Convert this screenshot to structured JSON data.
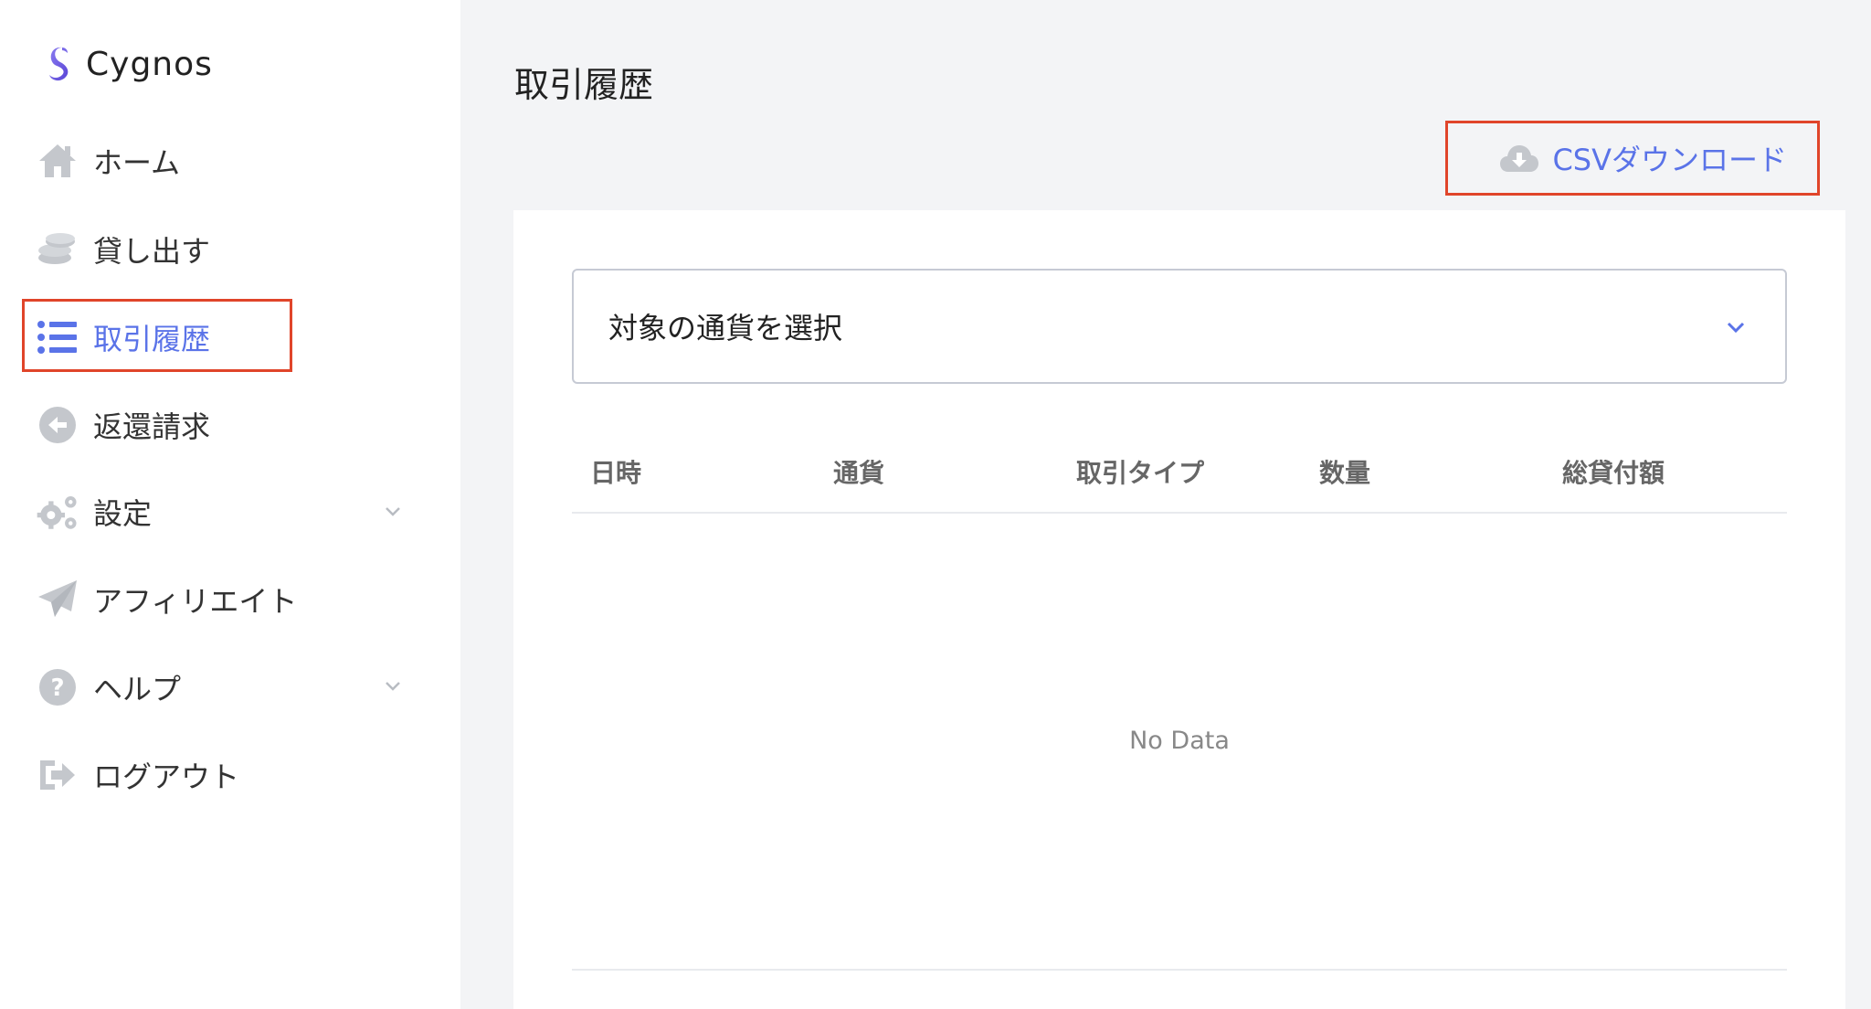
{
  "brand": {
    "name": "Cygnos",
    "color": "#6b5be6"
  },
  "sidebar": {
    "items": [
      {
        "label": "ホーム",
        "icon": "home-icon"
      },
      {
        "label": "貸し出す",
        "icon": "coins-icon"
      },
      {
        "label": "取引履歴",
        "icon": "list-icon",
        "active": true
      },
      {
        "label": "返還請求",
        "icon": "arrow-left-circle-icon"
      },
      {
        "label": "設定",
        "icon": "gears-icon",
        "expandable": true
      },
      {
        "label": "アフィリエイト",
        "icon": "paper-plane-icon"
      },
      {
        "label": "ヘルプ",
        "icon": "question-circle-icon",
        "expandable": true
      },
      {
        "label": "ログアウト",
        "icon": "logout-icon"
      }
    ]
  },
  "main": {
    "title": "取引履歴",
    "csv_download_label": "CSVダウンロード",
    "currency_select": {
      "placeholder": "対象の通貨を選択"
    },
    "table": {
      "columns": [
        "日時",
        "通貨",
        "取引タイプ",
        "数量",
        "総貸付額"
      ],
      "empty_text": "No Data"
    }
  },
  "colors": {
    "accent": "#5a73e8",
    "highlight": "#e0452a",
    "icon_gray": "#c4c7cc"
  }
}
